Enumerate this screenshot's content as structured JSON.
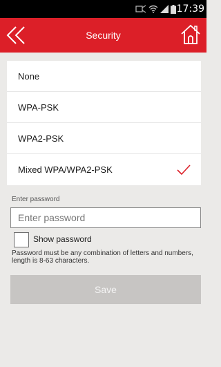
{
  "status_bar": {
    "time": "17:39",
    "icons": [
      "sim-icon",
      "wifi-icon",
      "signal-icon",
      "battery-icon"
    ]
  },
  "header": {
    "title": "Security",
    "back_icon": "double-chevron-left-icon",
    "home_icon": "home-icon"
  },
  "options": [
    {
      "label": "None",
      "selected": false
    },
    {
      "label": "WPA-PSK",
      "selected": false
    },
    {
      "label": "WPA2-PSK",
      "selected": false
    },
    {
      "label": "Mixed WPA/WPA2-PSK",
      "selected": true
    }
  ],
  "password": {
    "caption": "Enter password",
    "placeholder": "Enter password",
    "value": ""
  },
  "show_password": {
    "label": "Show password",
    "checked": false
  },
  "hint": "Password must be any combination of letters and numbers, length is 8-63 characters.",
  "save_label": "Save",
  "colors": {
    "accent": "#dc1f28",
    "background": "#ebeae8",
    "save_disabled": "#c7c5c3"
  }
}
